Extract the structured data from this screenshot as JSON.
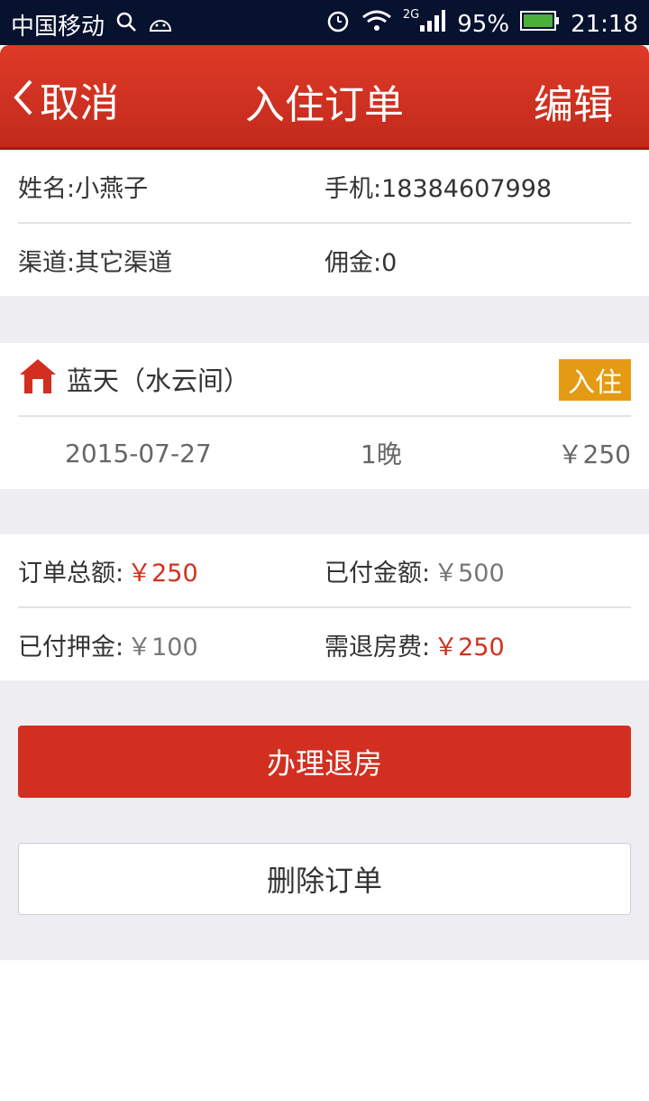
{
  "statusbar": {
    "carrier": "中国移动",
    "network": "2G",
    "battery": "95%",
    "time": "21:18"
  },
  "header": {
    "back_label": "取消",
    "title": "入住订单",
    "edit_label": "编辑"
  },
  "guest": {
    "name": "姓名:小燕子",
    "phone": "手机:18384607998",
    "channel": "渠道:其它渠道",
    "commission": "佣金:0"
  },
  "room": {
    "name": "蓝天（水云间）",
    "badge": "入住",
    "date": "2015-07-27",
    "nights": "1晚",
    "price": "￥250"
  },
  "summary": {
    "total_label": "订单总额:",
    "total_value": "￥250",
    "paid_label": "已付金额:",
    "paid_value": "￥500",
    "deposit_label": "已付押金:",
    "deposit_value": "￥100",
    "refund_label": "需退房费:",
    "refund_value": "￥250"
  },
  "actions": {
    "checkout_label": "办理退房",
    "delete_label": "删除订单"
  },
  "colors": {
    "primary": "#d22f20",
    "badge": "#e49a12",
    "statusbar": "#07122f"
  }
}
